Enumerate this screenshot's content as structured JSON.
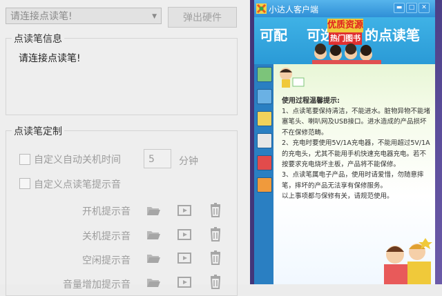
{
  "left_panel": {
    "device_select": {
      "value": "请连接点读笔!"
    },
    "eject_button": "弹出硬件",
    "info_group": {
      "legend": "点读笔信息",
      "text": "请连接点读笔!"
    },
    "custom_group": {
      "legend": "点读笔定制",
      "auto_off": {
        "label": "自定义自动关机时间",
        "value": "5",
        "unit": "分钟"
      },
      "custom_prompt": {
        "label": "自定义点读笔提示音"
      },
      "sounds": [
        {
          "label": "开机提示音"
        },
        {
          "label": "关机提示音"
        },
        {
          "label": "空闲提示音"
        },
        {
          "label": "音量增加提示音"
        }
      ]
    }
  },
  "app_window": {
    "title": "小达人客户端",
    "banner": {
      "text1": "可配",
      "text2": "可选",
      "text3": "的点读笔",
      "highlight_line1": "优质资源",
      "highlight_line2": "热门图书"
    },
    "sidebar_icons": [
      "plant-icon",
      "book-icon",
      "chart-icon",
      "notes-icon",
      "medkit-icon",
      "store-icon"
    ],
    "tips": {
      "title": "使用过程温馨提示:",
      "items": [
        "1、点读笔要保持清洁，不能进水。脏物异物不能堵塞笔头、喇叭网及USB接口。进水造成的产品损坏不在保修范畴。",
        "2、充电时要使用5V/1A充电器，不能用超过5V/1A的充电头，尤其不能用手机快速充电器充电。若不按要求充电烧坏主板，产品将不能保修。",
        "3、点读笔属电子产品，使用时请爱惜，勿随意摔笔，摔坏的产品无法享有保修服务。",
        "以上事项都与保修有关，请规范使用。"
      ]
    }
  },
  "colors": {
    "titlebar": "#2f8fd6",
    "banner_bg": "#3fb2e6",
    "highlight_yellow": "#f0c93a",
    "highlight_red": "#e03030",
    "desktop_purple": "#5a4c99"
  }
}
